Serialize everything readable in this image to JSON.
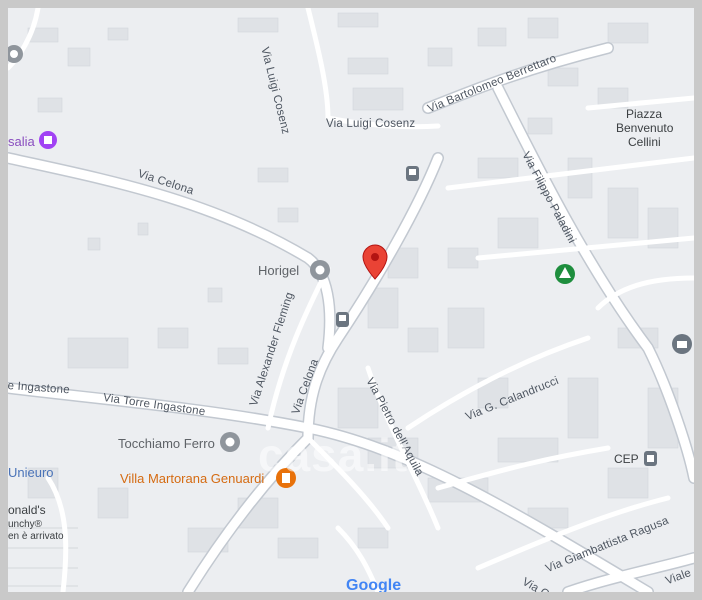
{
  "map": {
    "streets": {
      "luigi_cosenz_v": "Via Luigi Cosenz",
      "luigi_cosenz_h": "Via Luigi Cosenz",
      "bartolomeo": "Via Bartolomeo Berrettaro",
      "celona_upper": "Via Celona",
      "celona_lower": "Via Celona",
      "filippo": "Via Filippo Paladini",
      "fleming": "Via Alexander Fleming",
      "torre": "Via Torre Ingastone",
      "ingastone": "e Ingastone",
      "pietro": "Via Pietro dell'Aquila",
      "calandrucci": "Via G. Calandrucci",
      "ragusa": "Via Giambattista Ragusa",
      "viale": "Viale",
      "via_co": "Via Co"
    },
    "places": {
      "piazza_1": "Piazza",
      "piazza_2": "Benvenuto",
      "piazza_3": "Cellini",
      "horigel": "Horigel",
      "tocchiamo": "Tocchiamo Ferro",
      "villa": "Villa Martorana Genuardi",
      "unieuro": "Unieuro",
      "mcd_1": "onald's",
      "mcd_2": "unchy®",
      "mcd_3": "en è arrivato",
      "cep": "CEP",
      "salia": "salia"
    },
    "google": "Google",
    "watermark": "casa.it",
    "colors": {
      "pin": "#ea4335",
      "park": "#1e8e3e",
      "poi_orange": "#e8710a",
      "poi_gray": "#70757a",
      "poi_purple": "#a142f4"
    }
  }
}
